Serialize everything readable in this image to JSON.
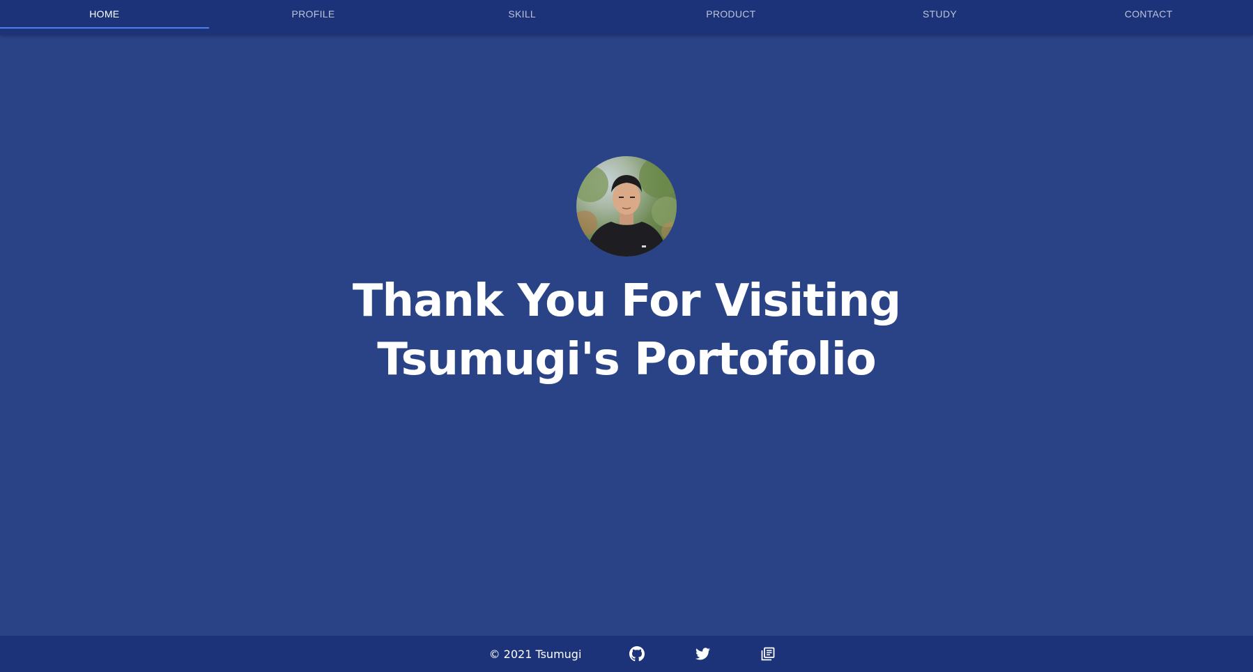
{
  "nav": {
    "tabs": [
      {
        "label": "HOME",
        "active": true
      },
      {
        "label": "PROFILE",
        "active": false
      },
      {
        "label": "SKILL",
        "active": false
      },
      {
        "label": "PRODUCT",
        "active": false
      },
      {
        "label": "STUDY",
        "active": false
      },
      {
        "label": "CONTACT",
        "active": false
      }
    ]
  },
  "hero": {
    "title_line1": "Thank You For Visiting",
    "title_line2": "Tsumugi's Portofolio"
  },
  "footer": {
    "copyright": "© 2021 Tsumugi",
    "icons": [
      "github-icon",
      "twitter-icon",
      "blog-icon"
    ]
  },
  "colors": {
    "background": "#2a4387",
    "nav": "#1c337a",
    "accent": "#4d80ee",
    "text": "#ffffff"
  }
}
